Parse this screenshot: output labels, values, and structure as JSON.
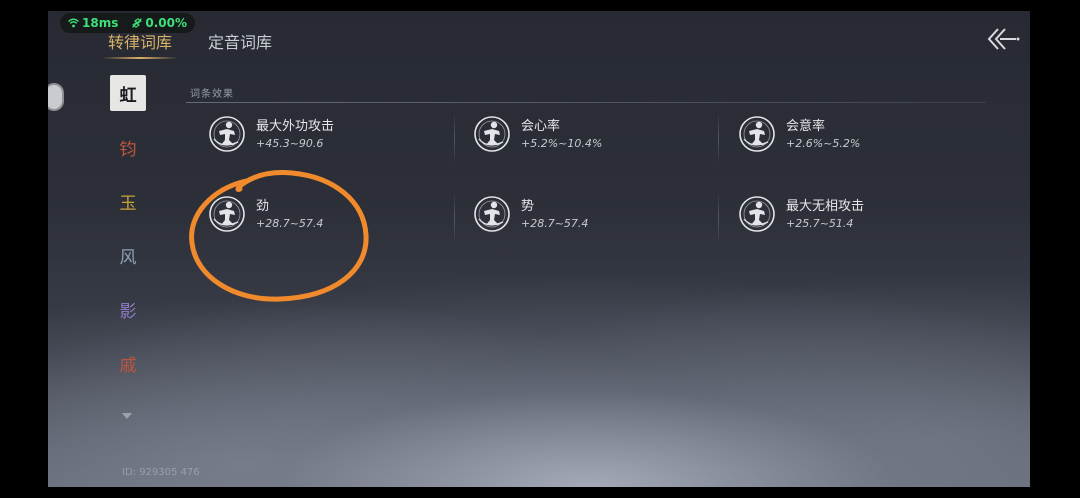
{
  "status": {
    "ping": "18ms",
    "loss": "0.00%",
    "color": "#3ee07a"
  },
  "tabs": [
    {
      "label": "转律词库",
      "active": true
    },
    {
      "label": "定音词库",
      "active": false
    }
  ],
  "sidebar": {
    "items": [
      {
        "label": "虹",
        "active": true,
        "color": "#1a1b1f"
      },
      {
        "label": "钧",
        "active": false,
        "color": "#c0553e"
      },
      {
        "label": "玉",
        "active": false,
        "color": "#c9a23a"
      },
      {
        "label": "风",
        "active": false,
        "color": "#8fa1b8"
      },
      {
        "label": "影",
        "active": false,
        "color": "#8f7fc9"
      },
      {
        "label": "戚",
        "active": false,
        "color": "#c0553e"
      }
    ],
    "scroll_icon": "chevron-down-icon"
  },
  "section": {
    "title": "词条效果"
  },
  "effects": [
    {
      "name": "最大外功攻击",
      "range": "+45.3~90.6",
      "icon": "warrior-emblem-icon"
    },
    {
      "name": "会心率",
      "range": "+5.2%~10.4%",
      "icon": "warrior-emblem-icon"
    },
    {
      "name": "会意率",
      "range": "+2.6%~5.2%",
      "icon": "warrior-emblem-icon"
    },
    {
      "name": "劲",
      "range": "+28.7~57.4",
      "icon": "warrior-emblem-icon"
    },
    {
      "name": "势",
      "range": "+28.7~57.4",
      "icon": "warrior-emblem-icon"
    },
    {
      "name": "最大无相攻击",
      "range": "+25.7~51.4",
      "icon": "warrior-emblem-icon"
    }
  ],
  "footer": {
    "id_text": "ID: 929305 476"
  },
  "annotation": {
    "color": "#f08a2c"
  },
  "back_icon": "back-arrow-icon"
}
